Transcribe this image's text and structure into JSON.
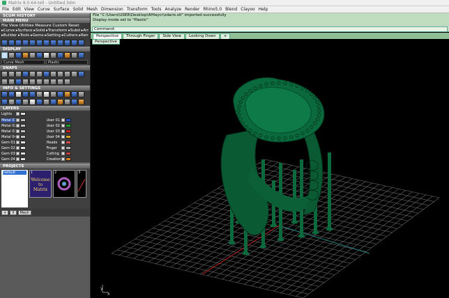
{
  "window": {
    "title": "Matrix 9.0.64-tell - Untitled.3dm"
  },
  "menubar": [
    "File",
    "Edit",
    "View",
    "Curve",
    "Surface",
    "Solid",
    "Mesh",
    "Dimension",
    "Transform",
    "Tools",
    "Analyze",
    "Render",
    "Rhino5.0",
    "Blend",
    "Clayoo",
    "Help"
  ],
  "left_panel": {
    "scum_history": "SCUM HISTORY",
    "main_menu": "MAIN MENU",
    "menu_row1": "File  View  Utilities  Measure  Custom       Reset",
    "menu_row2": "▸Curve ▸Surface ▸Solid ▸Transform ▸Subd ▸Arr",
    "menu_row3": "▸Builder ▸Tools ▸Gems ▸Setting ▸Cutters ▸Render",
    "display": "DISPLAY",
    "display_field1": "Curve Mesh",
    "display_field2": "Plastic",
    "snaps": "SNAPS",
    "info_settings": "INFO & SETTINGS",
    "layers": "LAYERS",
    "layers_lights": "Lights",
    "layers_left": [
      "Metal 01",
      "Metal 02",
      "Metal 03",
      "Metal 04",
      "Gem 01",
      "Gem 02",
      "Gem 03",
      "Gem 04"
    ],
    "layers_right": [
      "User 01",
      "User 02",
      "User 03",
      "User 04",
      "Heads",
      "Finger",
      "Cutting",
      "Creation"
    ],
    "projects": "PROJECTS",
    "project_default": "Default",
    "welcome_line1": "Welcome to",
    "welcome_line2": "Matrix",
    "btn_new": "+",
    "btn_del": "X",
    "btn_more": "Mesh"
  },
  "command": {
    "line1": "File \"C:\\Users\\USER\\Desktop\\AHlaycr\\zdaris.stl\" imported successfully",
    "line2": "Display mode set to \"Plastic\"",
    "prompt": "Command:"
  },
  "viewport_tabs": [
    "Perspective",
    "Through Finger",
    "Side View",
    "Looking Down",
    "+"
  ],
  "active_tab": "Perspective",
  "viewport_label": "Perspective",
  "axis": {
    "x": "x",
    "y": "y"
  },
  "colors": {
    "model": "#0a6a3e",
    "grid": "#6a6a6a",
    "x_axis": "#c02020",
    "y_axis": "#208080",
    "panel": "#3a3a3a"
  }
}
